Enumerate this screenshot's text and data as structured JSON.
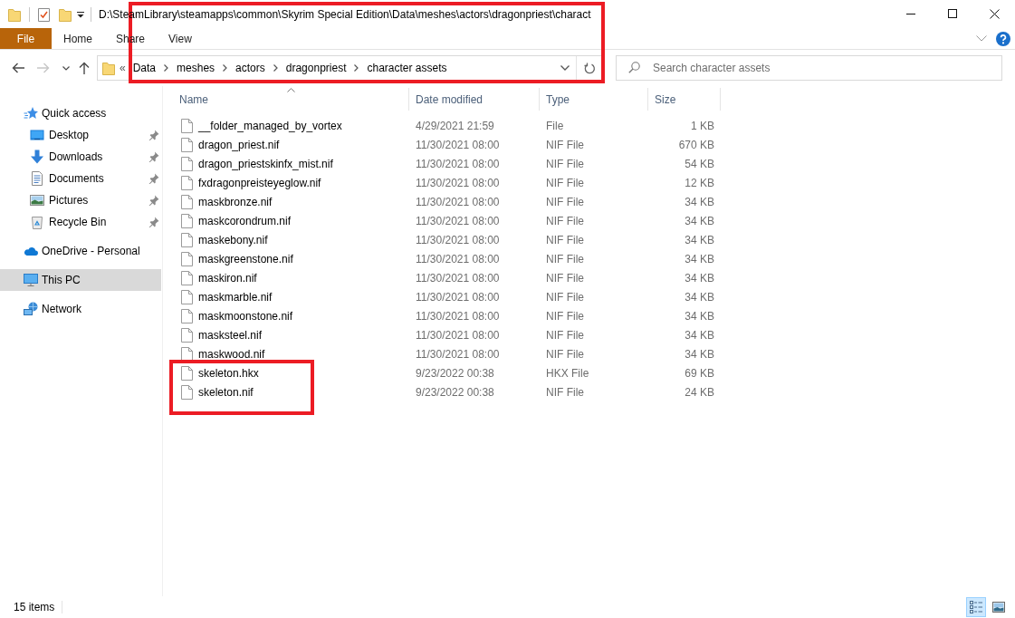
{
  "window": {
    "title": "D:\\SteamLibrary\\steamapps\\common\\Skyrim Special Edition\\Data\\meshes\\actors\\dragonpriest\\charact"
  },
  "ribbon": {
    "tabs": [
      {
        "label": "File",
        "kind": "file",
        "selected": false
      },
      {
        "label": "Home",
        "kind": "tab",
        "selected": false
      },
      {
        "label": "Share",
        "kind": "tab",
        "selected": false
      },
      {
        "label": "View",
        "kind": "tab",
        "selected": false
      }
    ]
  },
  "navigation": [
    {
      "kind": "back",
      "disabled": false
    },
    {
      "kind": "forward",
      "disabled": true
    },
    {
      "kind": "recent",
      "disabled": false
    },
    {
      "kind": "up",
      "disabled": false
    }
  ],
  "address_bar": {
    "overflow": "«",
    "crumbs": [
      "Data",
      "meshes",
      "actors",
      "dragonpriest",
      "character assets"
    ],
    "highlighted": true
  },
  "search": {
    "placeholder": "Search character assets"
  },
  "sidebar": {
    "items": [
      {
        "label": "Quick access",
        "kind": "star",
        "selected": false,
        "children": [
          {
            "label": "Desktop",
            "kind": "desktop",
            "selected": false,
            "pinned": true
          },
          {
            "label": "Downloads",
            "kind": "downloads",
            "selected": false,
            "pinned": true
          },
          {
            "label": "Documents",
            "kind": "documents",
            "selected": false,
            "pinned": true
          },
          {
            "label": "Pictures",
            "kind": "pictures",
            "selected": false,
            "pinned": true
          },
          {
            "label": "Recycle Bin",
            "kind": "recycle",
            "selected": false,
            "pinned": true
          }
        ]
      },
      {
        "label": "OneDrive - Personal",
        "kind": "cloud",
        "selected": false
      },
      {
        "label": "This PC",
        "kind": "computer",
        "selected": true
      },
      {
        "label": "Network",
        "kind": "network",
        "selected": false
      }
    ]
  },
  "table": {
    "columns": [
      {
        "label": "Name",
        "sorted": true
      },
      {
        "label": "Date modified",
        "sorted": false
      },
      {
        "label": "Type",
        "sorted": false
      },
      {
        "label": "Size",
        "sorted": false
      }
    ],
    "rows": [
      {
        "name": "__folder_managed_by_vortex",
        "date": "4/29/2021 21:59",
        "type": "File",
        "size": "1 KB",
        "highlighted": false
      },
      {
        "name": "dragon_priest.nif",
        "date": "11/30/2021 08:00",
        "type": "NIF File",
        "size": "670 KB",
        "highlighted": false
      },
      {
        "name": "dragon_priestskinfx_mist.nif",
        "date": "11/30/2021 08:00",
        "type": "NIF File",
        "size": "54 KB",
        "highlighted": false
      },
      {
        "name": "fxdragonpreisteyeglow.nif",
        "date": "11/30/2021 08:00",
        "type": "NIF File",
        "size": "12 KB",
        "highlighted": false
      },
      {
        "name": "maskbronze.nif",
        "date": "11/30/2021 08:00",
        "type": "NIF File",
        "size": "34 KB",
        "highlighted": false
      },
      {
        "name": "maskcorondrum.nif",
        "date": "11/30/2021 08:00",
        "type": "NIF File",
        "size": "34 KB",
        "highlighted": false
      },
      {
        "name": "maskebony.nif",
        "date": "11/30/2021 08:00",
        "type": "NIF File",
        "size": "34 KB",
        "highlighted": false
      },
      {
        "name": "maskgreenstone.nif",
        "date": "11/30/2021 08:00",
        "type": "NIF File",
        "size": "34 KB",
        "highlighted": false
      },
      {
        "name": "maskiron.nif",
        "date": "11/30/2021 08:00",
        "type": "NIF File",
        "size": "34 KB",
        "highlighted": false
      },
      {
        "name": "maskmarble.nif",
        "date": "11/30/2021 08:00",
        "type": "NIF File",
        "size": "34 KB",
        "highlighted": false
      },
      {
        "name": "maskmoonstone.nif",
        "date": "11/30/2021 08:00",
        "type": "NIF File",
        "size": "34 KB",
        "highlighted": false
      },
      {
        "name": "masksteel.nif",
        "date": "11/30/2021 08:00",
        "type": "NIF File",
        "size": "34 KB",
        "highlighted": false
      },
      {
        "name": "maskwood.nif",
        "date": "11/30/2021 08:00",
        "type": "NIF File",
        "size": "34 KB",
        "highlighted": false
      },
      {
        "name": "skeleton.hkx",
        "date": "9/23/2022 00:38",
        "type": "HKX File",
        "size": "69 KB",
        "highlighted": true
      },
      {
        "name": "skeleton.nif",
        "date": "9/23/2022 00:38",
        "type": "NIF File",
        "size": "24 KB",
        "highlighted": true
      }
    ]
  },
  "status_bar": {
    "item_count": "15 items",
    "views": [
      {
        "kind": "details",
        "selected": true
      },
      {
        "kind": "tiles",
        "selected": false
      }
    ]
  }
}
